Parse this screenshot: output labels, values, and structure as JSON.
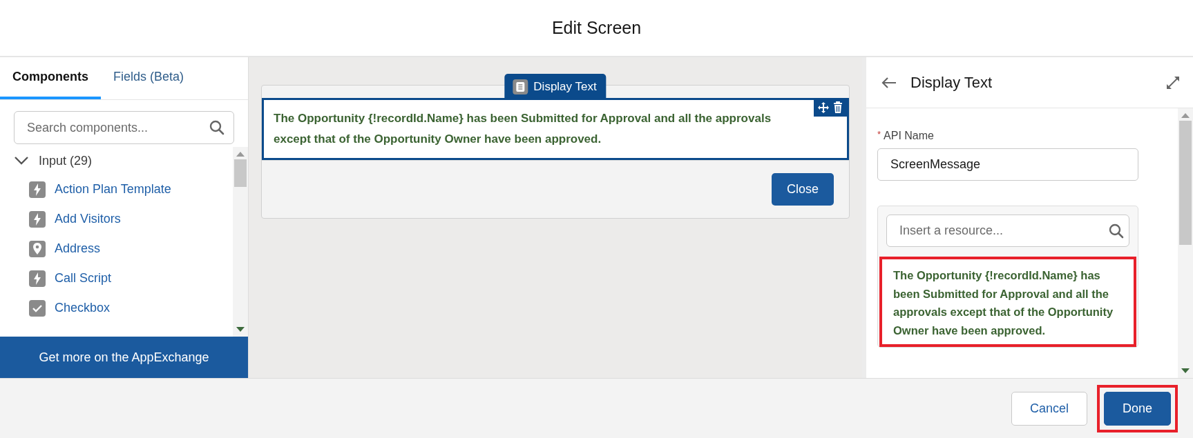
{
  "window": {
    "title": "Edit Screen"
  },
  "left_panel": {
    "tabs": [
      {
        "label": "Components",
        "selected": true
      },
      {
        "label": "Fields (Beta)",
        "selected": false
      }
    ],
    "search": {
      "placeholder": "Search components..."
    },
    "group": {
      "label": "Input (29)",
      "expanded": true,
      "items": [
        {
          "label": "Action Plan Template",
          "kind": "lightning"
        },
        {
          "label": "Add Visitors",
          "kind": "lightning"
        },
        {
          "label": "Address",
          "kind": "location"
        },
        {
          "label": "Call Script",
          "kind": "lightning"
        },
        {
          "label": "Checkbox",
          "kind": "checkbox"
        }
      ]
    },
    "footer_link": "Get more on the AppExchange"
  },
  "canvas": {
    "component_tab": "Display Text",
    "message": "The Opportunity {!recordId.Name} has been Submitted for Approval and all the approvals except that of the Opportunity Owner have been approved.",
    "selected": true,
    "close_button": "Close"
  },
  "properties": {
    "title": "Display Text",
    "api_name": {
      "label": "API Name",
      "required_marker": "*",
      "value": "ScreenMessage"
    },
    "resource_search": {
      "placeholder": "Insert a resource..."
    },
    "message": "The Opportunity {!recordId.Name} has been Submitted for Approval and all the approvals except that of the Opportunity Owner have been approved.",
    "highlighted": true
  },
  "footer": {
    "buttons": [
      {
        "label": "Cancel",
        "kind": "neutral",
        "highlighted": false
      },
      {
        "label": "Done",
        "kind": "brand",
        "highlighted": true
      }
    ]
  }
}
